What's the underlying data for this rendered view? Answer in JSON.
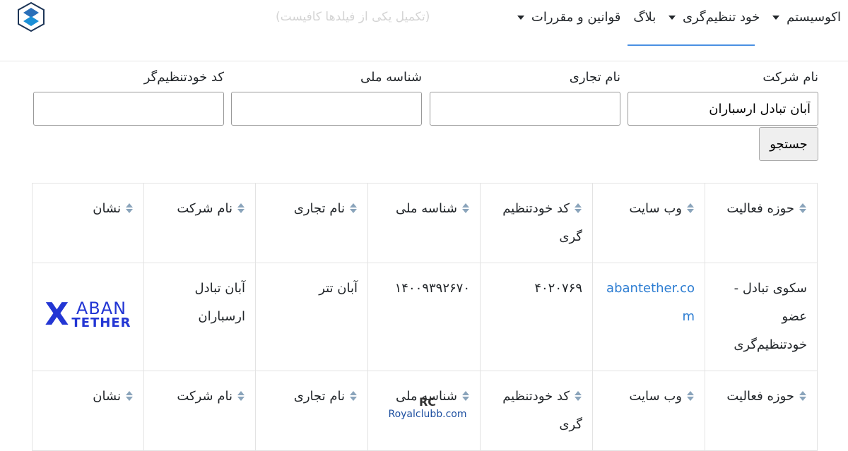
{
  "nav": {
    "items": [
      {
        "label": "اکوسیستم",
        "dropdown": true
      },
      {
        "label": "خود تنظیم‌گری",
        "dropdown": true
      },
      {
        "label": "بلاگ",
        "dropdown": false
      },
      {
        "label": "قوانین و مقررات",
        "dropdown": true
      }
    ],
    "ghost_text": "(تکمیل یکی از فیلدها کافیست)",
    "accent": "#4a90e2"
  },
  "filters": {
    "company_label": "نام شرکت",
    "company_value": "آبان تبادل ارسباران",
    "trade_label": "نام تجاری",
    "national_label": "شناسه ملی",
    "code_label": "کد خودتنظیم‌گر",
    "search_button": "جستجو"
  },
  "table": {
    "headers": {
      "field": "حوزه فعالیت",
      "website": "وب سایت",
      "code": "کد خودتنظیم گری",
      "national": "شناسه ملی",
      "trade": "نام تجاری",
      "company": "نام شرکت",
      "logo": "نشان"
    },
    "row": {
      "field": "سکوی تبادل - عضو خودتنظیم‌گری",
      "website": "abantether.com",
      "code": "۴۰۲۰۷۶۹",
      "national": "۱۴۰۰۹۳۹۲۶۷۰",
      "trade": "آبان تتر",
      "company": "آبان تبادل ارسباران",
      "logo_mark": "X",
      "logo_word1": "ABAN",
      "logo_word2": "TETHER"
    },
    "headers2": {
      "field": "حوزه فعالیت",
      "website": "وب سایت",
      "code": "کد خودتنظیم گری",
      "national": "شناسه ملی",
      "trade": "نام تجاری",
      "company": "نام شرکت",
      "logo": "نشان"
    }
  },
  "watermark": {
    "mark": "RC",
    "text": "Royalclubb.com"
  }
}
